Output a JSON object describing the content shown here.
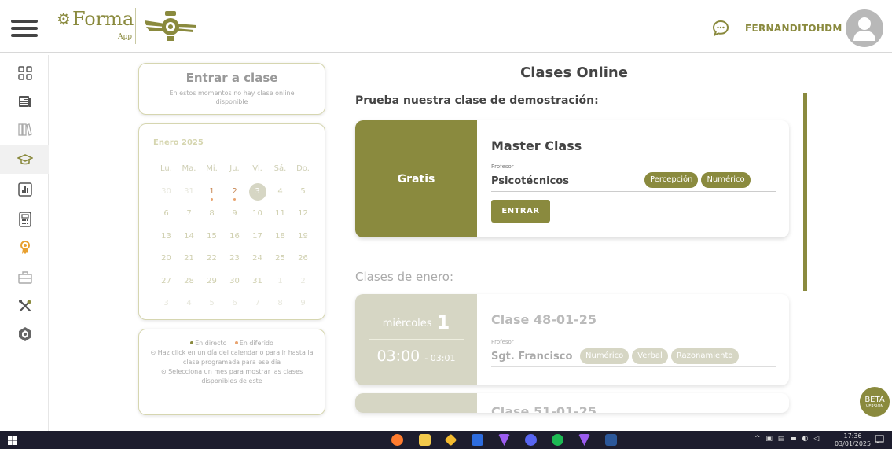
{
  "header": {
    "logo_text": "Forma",
    "logo_sub": "App",
    "username": "FERNANDITOHDM"
  },
  "sidebar": {
    "items": [
      {
        "icon": "grid-icon"
      },
      {
        "icon": "newspaper-icon"
      },
      {
        "icon": "books-icon"
      },
      {
        "icon": "graduation-cap-icon",
        "active": true
      },
      {
        "icon": "bar-chart-icon"
      },
      {
        "icon": "calculator-icon"
      },
      {
        "icon": "award-ribbon-icon"
      },
      {
        "icon": "briefcase-icon"
      },
      {
        "icon": "tools-icon"
      },
      {
        "icon": "forma-logo-icon"
      }
    ]
  },
  "enter_class": {
    "title": "Entrar a clase",
    "subtitle": "En estos momentos no hay clase online disponible"
  },
  "calendar": {
    "month": "Enero 2025",
    "weekdays": [
      "Lu.",
      "Ma.",
      "Mi.",
      "Ju.",
      "Vi.",
      "Sá.",
      "Do."
    ],
    "weeks": [
      [
        "30",
        "31",
        "1",
        "2",
        "3",
        "4",
        "5"
      ],
      [
        "6",
        "7",
        "8",
        "9",
        "10",
        "11",
        "12"
      ],
      [
        "13",
        "14",
        "15",
        "16",
        "17",
        "18",
        "19"
      ],
      [
        "20",
        "21",
        "22",
        "23",
        "24",
        "25",
        "26"
      ],
      [
        "27",
        "28",
        "29",
        "30",
        "31",
        "1",
        "2"
      ],
      [
        "3",
        "4",
        "5",
        "6",
        "7",
        "8",
        "9"
      ]
    ],
    "today": "3",
    "marked_days": [
      "1",
      "2"
    ]
  },
  "legend": {
    "live": "En directo",
    "deferred": "En diferido",
    "hint1": "⊙ Haz click en un día del calendario para ir hasta la clase programada para ese día",
    "hint2": "⊙ Selecciona un mes para mostrar las clases disponibles de este",
    "live_color": "#8a8a3e",
    "deferred_color": "#e8a470"
  },
  "main": {
    "title": "Clases Online",
    "demo_label": "Prueba nuestra clase de demostración:",
    "month_label": "Clases de enero:"
  },
  "master_class": {
    "badge": "Gratis",
    "title": "Master Class",
    "professor_label": "Profesor",
    "professor": "Psicotécnicos",
    "tags": [
      "Percepción",
      "Numérico"
    ],
    "button": "ENTRAR"
  },
  "classes": [
    {
      "weekday": "miércoles",
      "day": "1",
      "time_start": "03:00",
      "time_end": "- 03:01",
      "title": "Clase 48-01-25",
      "professor_label": "Profesor",
      "professor": "Sgt. Francisco",
      "tags": [
        "Numérico",
        "Verbal",
        "Razonamiento"
      ]
    },
    {
      "title": "Clase 51-01-25"
    }
  ],
  "beta": {
    "main": "BETA",
    "sub": "VERSION"
  },
  "taskbar": {
    "time": "17:36",
    "date": "03/01/2025"
  },
  "colors": {
    "accent": "#8a8a3e",
    "accent_light": "#d6d6c4"
  }
}
